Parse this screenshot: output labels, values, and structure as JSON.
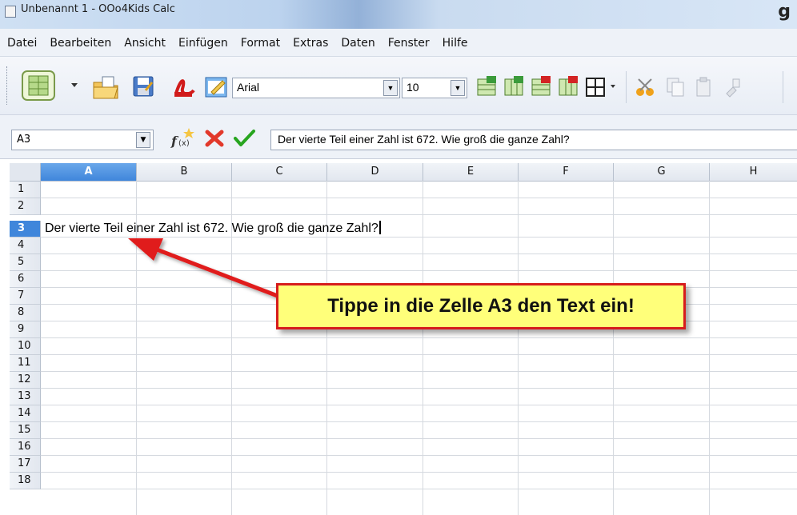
{
  "window": {
    "title": "Unbenannt 1 - OOo4Kids Calc",
    "corner_text": "g"
  },
  "menu": [
    "Datei",
    "Bearbeiten",
    "Ansicht",
    "Einfügen",
    "Format",
    "Extras",
    "Daten",
    "Fenster",
    "Hilfe"
  ],
  "toolbar": {
    "font_name": "Arial",
    "font_size": "10"
  },
  "formula": {
    "name_box": "A3",
    "input": "Der vierte Teil einer Zahl ist 672. Wie groß die ganze Zahl?"
  },
  "grid": {
    "columns": [
      "A",
      "B",
      "C",
      "D",
      "E",
      "F",
      "G",
      "H"
    ],
    "rows": [
      "1",
      "2",
      "3",
      "4",
      "5",
      "6",
      "7",
      "8",
      "9",
      "10",
      "11",
      "12",
      "13",
      "14",
      "15",
      "16",
      "17",
      "18"
    ],
    "active_column": "A",
    "active_row": "3",
    "cell_a3": "Der vierte Teil einer Zahl ist 672. Wie groß die ganze Zahl?"
  },
  "callout": {
    "text": "Tippe in die Zelle A3 den Text ein!"
  },
  "colors": {
    "accent_red": "#d61c1c",
    "callout_yellow": "#ffff7a",
    "selection_blue": "#3f86db"
  }
}
